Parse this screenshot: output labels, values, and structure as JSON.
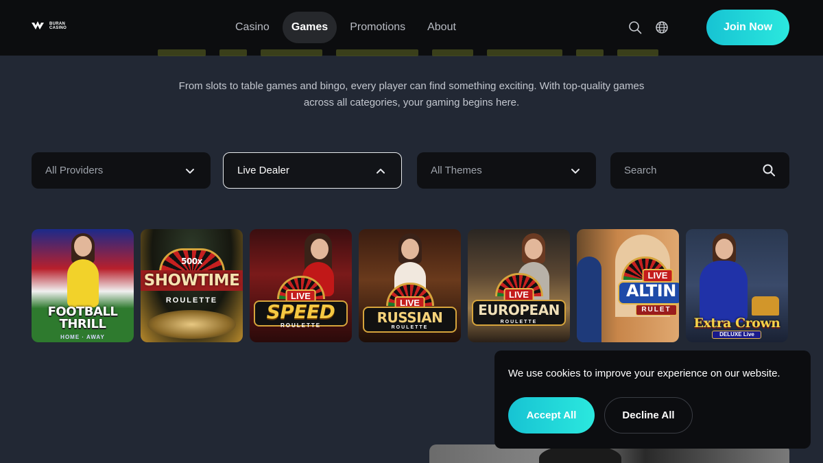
{
  "brand": {
    "logo_line1": "BURAN",
    "logo_line2": "CASINO"
  },
  "nav": {
    "items": [
      {
        "label": "Casino"
      },
      {
        "label": "Games"
      },
      {
        "label": "Promotions"
      },
      {
        "label": "About"
      }
    ],
    "active": "Games",
    "join_label": "Join Now",
    "icons": [
      "search-icon",
      "globe-icon"
    ]
  },
  "intro": {
    "line1": "From slots to table games and bingo, every player can find something exciting. With top-quality games",
    "line2": "across all categories, your gaming begins here."
  },
  "filters": {
    "providers": "All Providers",
    "category": "Live Dealer",
    "themes": "All Themes",
    "search_placeholder": "Search"
  },
  "games": [
    {
      "title": "FOOTBALL THRILL",
      "t1": "FOOTBALL",
      "t2": "THRILL",
      "extra": "HOME · AWAY"
    },
    {
      "title": "500x SHOWTIME ROULETTE",
      "t0": "500x",
      "t1": "SHOWTIME",
      "t2": "ROULETTE"
    },
    {
      "title": "LIVE SPEED ROULETTE",
      "badge": "LIVE",
      "t1": "SPEED",
      "t2": "ROULETTE"
    },
    {
      "title": "LIVE RUSSIAN ROULETTE",
      "badge": "LIVE",
      "t1": "RUSSIAN",
      "t2": "ROULETTE"
    },
    {
      "title": "LIVE EUROPEAN ROULETTE",
      "badge": "LIVE",
      "t1": "EUROPEAN",
      "t2": "ROULETTE"
    },
    {
      "title": "LIVE ALTIN RULET",
      "badge": "LIVE",
      "t1": "ALTIN",
      "t2": "RULET"
    },
    {
      "title": "Extra Crown DELUXE Live",
      "t1": "Extra Crown",
      "t2": "DELUXE Live"
    }
  ],
  "cookie": {
    "message": "We use cookies to improve your experience on our website.",
    "accept_label": "Accept All",
    "decline_label": "Decline All"
  },
  "colors": {
    "accent_start": "#17c3d3",
    "accent_end": "#2be8de",
    "page_bg": "#222834",
    "header_bg": "#0c0d0f"
  }
}
